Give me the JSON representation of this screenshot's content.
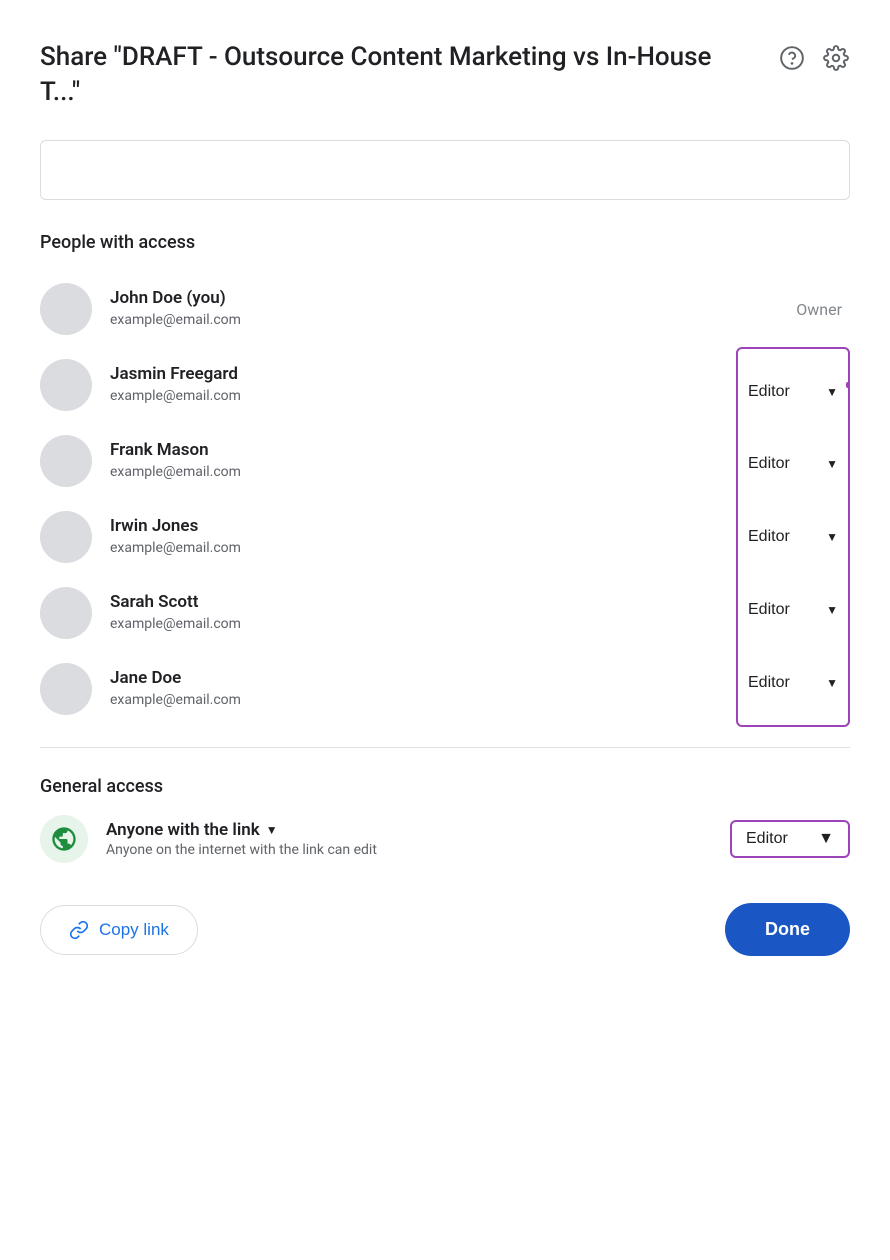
{
  "dialog": {
    "title": "Share \"DRAFT - Outsource Content Marketing vs In-House T...\"",
    "search_placeholder": ""
  },
  "icons": {
    "help": "?",
    "settings": "⚙"
  },
  "sections": {
    "people_with_access": "People with access",
    "general_access": "General access"
  },
  "people": [
    {
      "name": "John Doe (you)",
      "email": "example@email.com",
      "role": "Owner",
      "is_owner": true
    },
    {
      "name": "Jasmin Freegard",
      "email": "example@email.com",
      "role": "Editor",
      "is_owner": false
    },
    {
      "name": "Frank Mason",
      "email": "example@email.com",
      "role": "Editor",
      "is_owner": false
    },
    {
      "name": "Irwin Jones",
      "email": "example@email.com",
      "role": "Editor",
      "is_owner": false
    },
    {
      "name": "Sarah Scott",
      "email": "example@email.com",
      "role": "Editor",
      "is_owner": false
    },
    {
      "name": "Jane Doe",
      "email": "example@email.com",
      "role": "Editor",
      "is_owner": false
    }
  ],
  "general_access": {
    "title": "Anyone with the link",
    "description": "Anyone on the internet with the link can edit",
    "role": "Editor"
  },
  "footer": {
    "copy_link": "Copy link",
    "done": "Done"
  }
}
